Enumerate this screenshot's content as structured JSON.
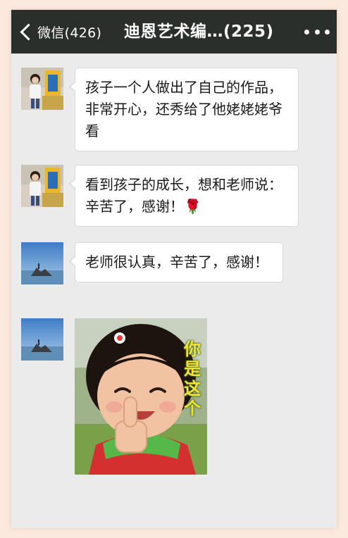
{
  "header": {
    "back_label": "微信(426)",
    "title": "迪恩艺术编…(225)"
  },
  "messages": [
    {
      "type": "text",
      "text": "孩子一个人做出了自己的作品，非常开心，还秀给了他姥姥姥爷看"
    },
    {
      "type": "text",
      "text": "看到孩子的成长，想和老师说：辛苦了，感谢！🌹"
    },
    {
      "type": "text",
      "text": "老师很认真，辛苦了，感谢！"
    },
    {
      "type": "sticker",
      "caption": "你是这个"
    }
  ],
  "colors": {
    "header_bg": "#2a2f2c",
    "chat_bg": "#ebebeb",
    "bubble_bg": "#ffffff"
  }
}
